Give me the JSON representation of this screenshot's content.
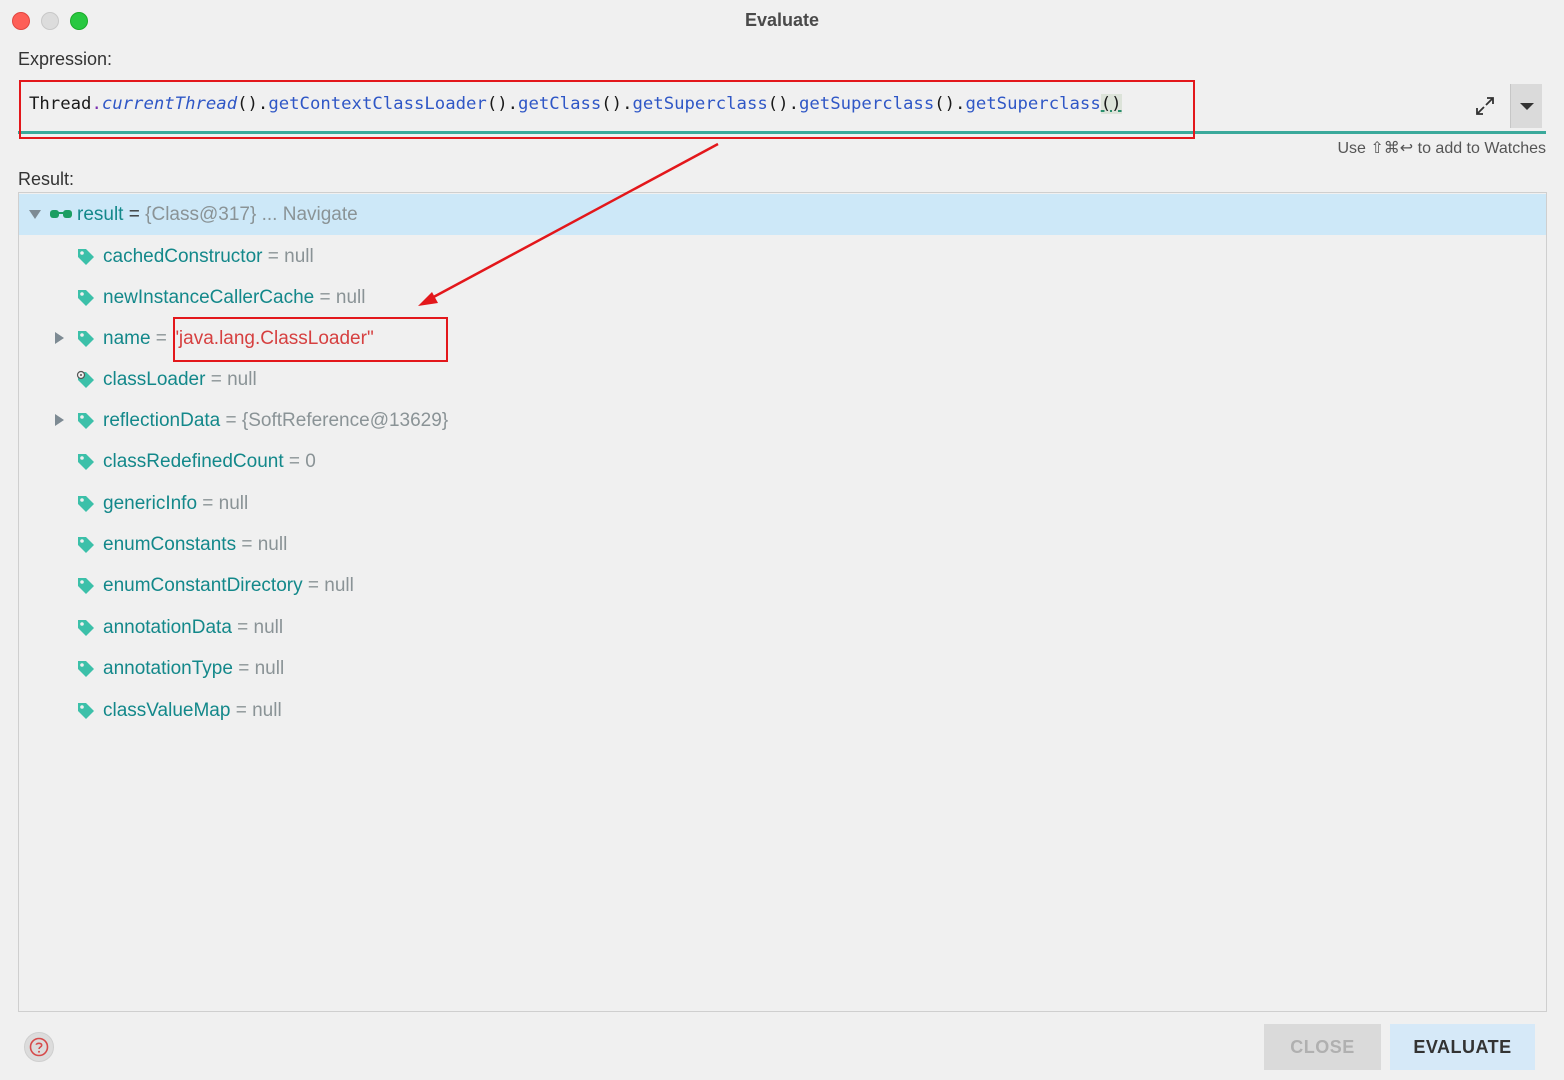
{
  "window": {
    "title": "Evaluate"
  },
  "expression": {
    "label": "Expression:",
    "parts": {
      "p1": "Thread",
      "p2": ".",
      "p3": "currentThread",
      "p4": "().",
      "p5": "getContextClassLoader",
      "p6": "().",
      "p7": "getClass",
      "p8": "().",
      "p9": "getSuperclass",
      "p10": "().",
      "p11": "getSuperclass",
      "p12": "().",
      "p13": "getSuperclass",
      "p14": "()"
    },
    "hint": "Use ⇧⌘↩ to add to Watches"
  },
  "result": {
    "label": "Result:",
    "root": {
      "name": "result",
      "eq": " = ",
      "value": "{Class@317}",
      "nav": " ... Navigate"
    },
    "fields": [
      {
        "name": "cachedConstructor",
        "eq": " = ",
        "value": "null"
      },
      {
        "name": "newInstanceCallerCache",
        "eq": " = ",
        "value": "null"
      },
      {
        "name": "name",
        "eq": " = ",
        "value": "\"java.lang.ClassLoader\""
      },
      {
        "name": "classLoader",
        "eq": " = ",
        "value": "null"
      },
      {
        "name": "reflectionData",
        "eq": " = ",
        "value": "{SoftReference@13629}"
      },
      {
        "name": "classRedefinedCount",
        "eq": " = ",
        "value": "0"
      },
      {
        "name": "genericInfo",
        "eq": " = ",
        "value": "null"
      },
      {
        "name": "enumConstants",
        "eq": " = ",
        "value": "null"
      },
      {
        "name": "enumConstantDirectory",
        "eq": " = ",
        "value": "null"
      },
      {
        "name": "annotationData",
        "eq": " = ",
        "value": "null"
      },
      {
        "name": "annotationType",
        "eq": " = ",
        "value": "null"
      },
      {
        "name": "classValueMap",
        "eq": " = ",
        "value": "null"
      }
    ]
  },
  "buttons": {
    "close": "CLOSE",
    "evaluate": "EVALUATE"
  },
  "colors": {
    "field": "#13888a",
    "string_value": "#d64040",
    "annotation_red": "#e3171b",
    "accent": "#3aa99b"
  }
}
